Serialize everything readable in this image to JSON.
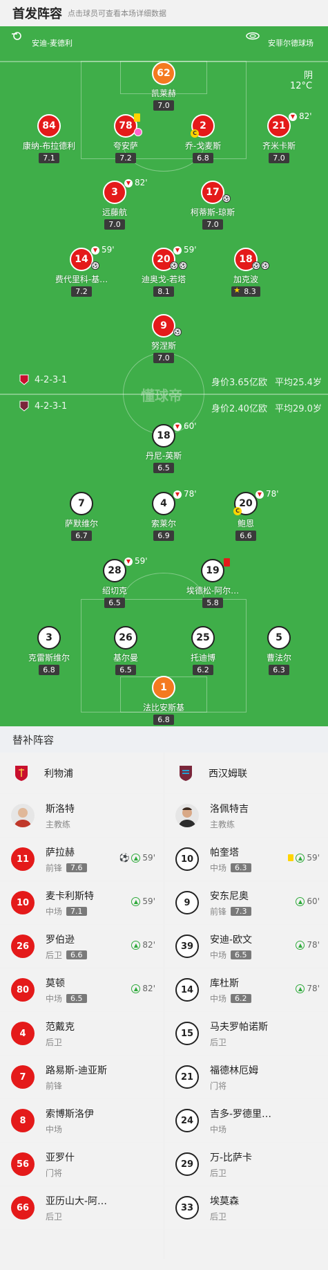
{
  "header": {
    "title": "首发阵容",
    "hint": "点击球员可查看本场详细数据"
  },
  "pitch": {
    "referee": "安迪-麦德利",
    "stadium": "安菲尔德球场",
    "weather": "阴",
    "temp": "12°C",
    "watermark": "懂球帝",
    "home_formation": "4-2-3-1",
    "home_value": "身价3.65亿欧",
    "home_age": "平均25.4岁",
    "away_formation": "4-2-3-1",
    "away_value": "身价2.40亿欧",
    "away_age": "平均29.0岁",
    "colors": {
      "home": "#e41a1a",
      "away": "#ffffff",
      "keeper": "#f47a20",
      "pitch": "#3fae49"
    }
  },
  "home_players": [
    {
      "num": "62",
      "name": "凯莱赫",
      "rating": "7.0",
      "kit": "orange"
    },
    {
      "num": "84",
      "name": "康纳-布拉德利",
      "rating": "7.1",
      "kit": "red"
    },
    {
      "num": "78",
      "name": "夸安萨",
      "rating": "7.2",
      "kit": "red"
    },
    {
      "num": "2",
      "name": "乔-戈麦斯",
      "rating": "6.8",
      "kit": "red"
    },
    {
      "num": "21",
      "name": "齐米卡斯",
      "rating": "7.0",
      "kit": "red",
      "sub_minute": "82'"
    },
    {
      "num": "3",
      "name": "远藤航",
      "rating": "7.0",
      "kit": "red",
      "sub_minute": "82'"
    },
    {
      "num": "17",
      "name": "柯蒂斯-琼斯",
      "rating": "7.0",
      "kit": "red"
    },
    {
      "num": "14",
      "name": "费代里科-基…",
      "rating": "7.2",
      "kit": "red",
      "sub_minute": "59'"
    },
    {
      "num": "20",
      "name": "迪奥戈-若塔",
      "rating": "8.1",
      "kit": "red",
      "sub_minute": "59'"
    },
    {
      "num": "18",
      "name": "加克波",
      "rating": "8.3",
      "kit": "red"
    },
    {
      "num": "9",
      "name": "努涅斯",
      "rating": "7.0",
      "kit": "red"
    }
  ],
  "away_players": [
    {
      "num": "18",
      "name": "丹尼-英斯",
      "rating": "6.5",
      "kit": "white",
      "sub_minute": "60'"
    },
    {
      "num": "7",
      "name": "萨默维尔",
      "rating": "6.7",
      "kit": "white"
    },
    {
      "num": "4",
      "name": "索莱尔",
      "rating": "6.9",
      "kit": "white",
      "sub_minute": "78'"
    },
    {
      "num": "20",
      "name": "鲍恩",
      "rating": "6.6",
      "kit": "white",
      "sub_minute": "78'"
    },
    {
      "num": "28",
      "name": "绍切克",
      "rating": "6.5",
      "kit": "white",
      "sub_minute": "59'"
    },
    {
      "num": "19",
      "name": "埃德松-阿尔…",
      "rating": "5.8",
      "kit": "white"
    },
    {
      "num": "3",
      "name": "克雷斯维尔",
      "rating": "6.8",
      "kit": "white"
    },
    {
      "num": "26",
      "name": "基尔曼",
      "rating": "6.5",
      "kit": "white"
    },
    {
      "num": "25",
      "name": "托迪博",
      "rating": "6.2",
      "kit": "white"
    },
    {
      "num": "5",
      "name": "曹法尔",
      "rating": "6.3",
      "kit": "white"
    },
    {
      "num": "1",
      "name": "法比安斯基",
      "rating": "6.8",
      "kit": "orange"
    }
  ],
  "subs": {
    "title": "替补阵容",
    "home": {
      "team": "利物浦",
      "coach": {
        "name": "斯洛特",
        "role": "主教练"
      },
      "players": [
        {
          "num": "11",
          "name": "萨拉赫",
          "pos": "前锋",
          "rating": "7.6",
          "minute": "59'"
        },
        {
          "num": "10",
          "name": "麦卡利斯特",
          "pos": "中场",
          "rating": "7.1",
          "minute": "59'"
        },
        {
          "num": "26",
          "name": "罗伯逊",
          "pos": "后卫",
          "rating": "6.6",
          "minute": "82'"
        },
        {
          "num": "80",
          "name": "莫顿",
          "pos": "中场",
          "rating": "6.5",
          "minute": "82'"
        },
        {
          "num": "4",
          "name": "范戴克",
          "pos": "后卫"
        },
        {
          "num": "7",
          "name": "路易斯-迪亚斯",
          "pos": "前锋"
        },
        {
          "num": "8",
          "name": "索博斯洛伊",
          "pos": "中场"
        },
        {
          "num": "56",
          "name": "亚罗什",
          "pos": "门将"
        },
        {
          "num": "66",
          "name": "亚历山大-阿…",
          "pos": "后卫"
        }
      ]
    },
    "away": {
      "team": "西汉姆联",
      "coach": {
        "name": "洛佩特吉",
        "role": "主教练"
      },
      "players": [
        {
          "num": "10",
          "name": "帕奎塔",
          "pos": "中场",
          "rating": "6.3",
          "minute": "59'"
        },
        {
          "num": "9",
          "name": "安东尼奥",
          "pos": "前锋",
          "rating": "7.3",
          "minute": "60'"
        },
        {
          "num": "39",
          "name": "安迪-欧文",
          "pos": "中场",
          "rating": "6.5",
          "minute": "78'"
        },
        {
          "num": "14",
          "name": "库杜斯",
          "pos": "中场",
          "rating": "6.2",
          "minute": "78'"
        },
        {
          "num": "15",
          "name": "马夫罗帕诺斯",
          "pos": "后卫"
        },
        {
          "num": "21",
          "name": "福德林厄姆",
          "pos": "门将"
        },
        {
          "num": "24",
          "name": "吉多-罗德里…",
          "pos": "中场"
        },
        {
          "num": "29",
          "name": "万-比萨卡",
          "pos": "后卫"
        },
        {
          "num": "33",
          "name": "埃莫森",
          "pos": "后卫"
        }
      ]
    }
  }
}
